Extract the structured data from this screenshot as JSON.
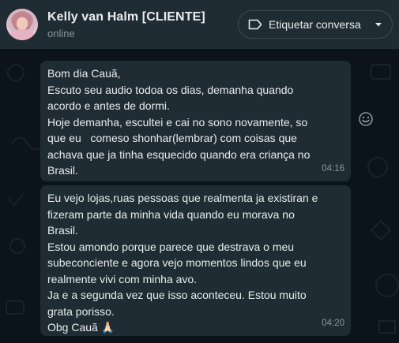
{
  "header": {
    "contact_name": "Kelly van Halm [CLIENTE]",
    "status": "online",
    "label_button": "Etiquetar conversa"
  },
  "messages": [
    {
      "lines": [
        "Bom dia Cauã,",
        "Escuto seu audio todoa os dias, demanha quando",
        "acordo e antes de dormi.",
        "Hoje demanha, escultei e cai no sono novamente, so",
        "que eu   comeso shonhar(lembrar) com coisas que",
        "achava que ja tinha esquecido quando era criança no",
        "Brasil."
      ],
      "time": "04:16"
    },
    {
      "lines": [
        "Eu vejo lojas,ruas pessoas que realmenta ja existiran e",
        "fizeram parte da minha vida quando eu morava no",
        "Brasil.",
        "Estou amondo porque parece que destrava o meu",
        "subeconciente e agora vejo momentos lindos que eu",
        "realmente vivi com minha avo.",
        "Ja e a segunda vez que isso aconteceu. Estou muito",
        "grata porisso.",
        "Obg Cauã"
      ],
      "emoji": "🙏🏻",
      "time": "04:20"
    }
  ],
  "icons": {
    "tag": "tag-icon",
    "caret": "chevron-down-icon",
    "react": "smiley-icon"
  },
  "colors": {
    "header_bg": "#202c33",
    "chat_bg": "#0b141a",
    "bubble_bg": "#202c33",
    "text_primary": "#e9edef",
    "text_secondary": "#8696a0"
  }
}
